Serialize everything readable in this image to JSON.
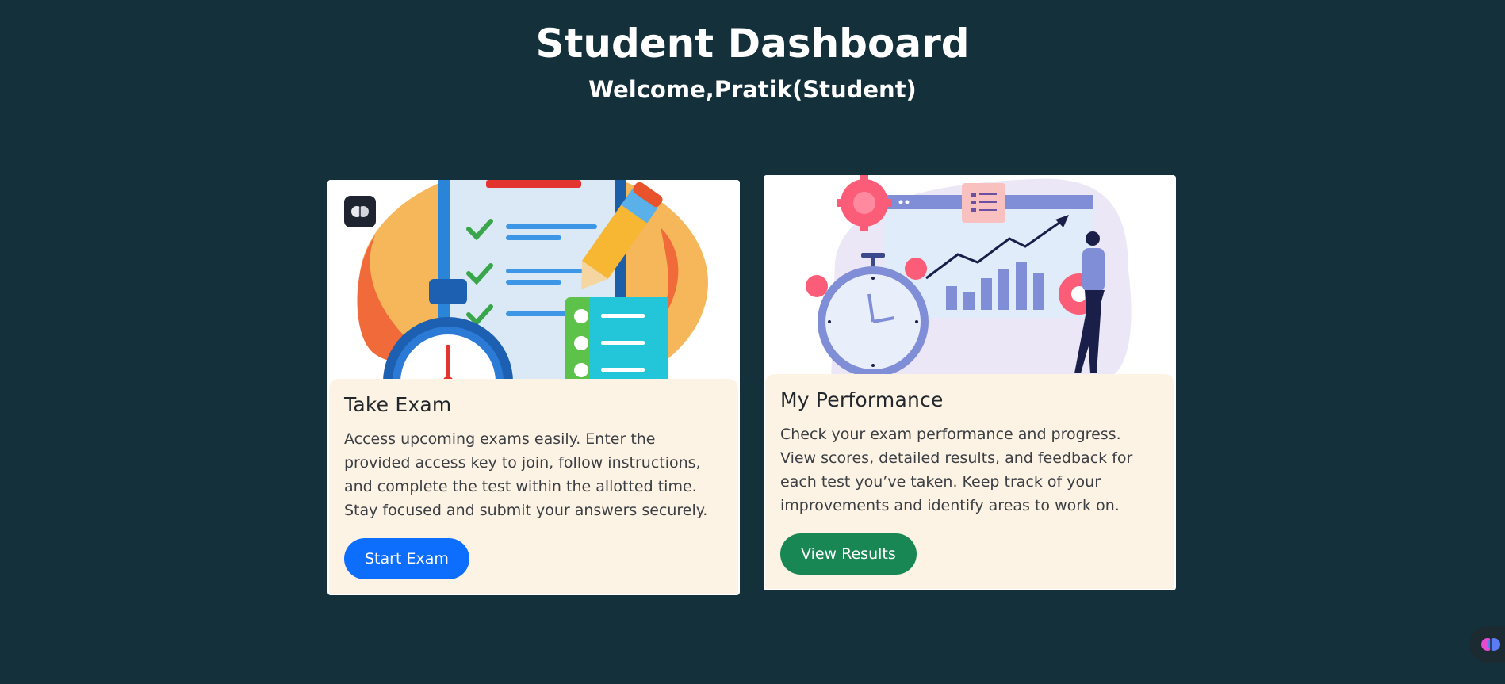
{
  "header": {
    "title": "Student Dashboard",
    "subtitle": "Welcome,Pratik(Student)"
  },
  "cards": [
    {
      "title": "Take Exam",
      "description": "Access upcoming exams easily. Enter the provided access key to join, follow instructions, and complete the test within the allotted time. Stay focused and submit your answers securely.",
      "button_label": "Start Exam",
      "illustration_icon": "exam-clipboard-stopwatch-illustration",
      "badge_icon": "brain-icon"
    },
    {
      "title": "My Performance",
      "description": "Check your exam performance and progress. View scores, detailed results, and feedback for each test you’ve taken. Keep track of your improvements and identify areas to work on.",
      "button_label": "View Results",
      "illustration_icon": "performance-chart-stopwatch-illustration"
    }
  ],
  "floating_widget": {
    "icon": "brain-icon"
  },
  "colors": {
    "background": "#14303a",
    "card_body": "#fdf3e5",
    "primary": "#0d6efd",
    "success": "#198754"
  }
}
